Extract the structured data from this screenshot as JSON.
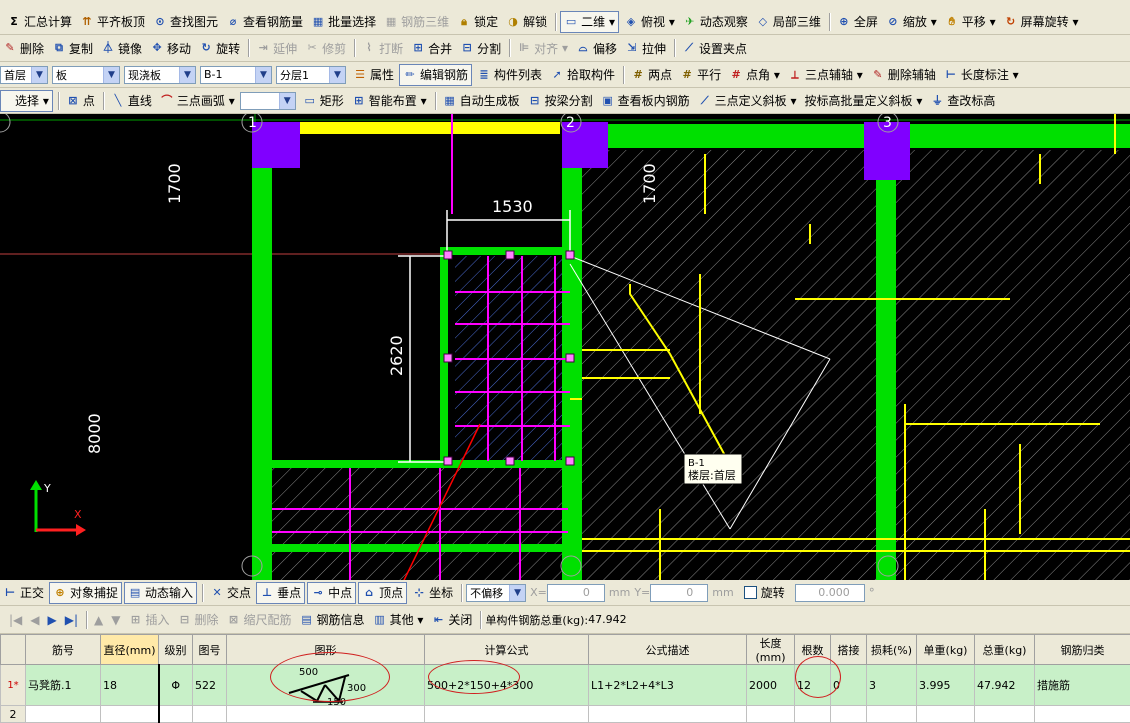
{
  "toolbar1": {
    "items": [
      "汇总计算",
      "平齐板顶",
      "查找图元",
      "查看钢筋量",
      "批量选择",
      "钢筋三维",
      "锁定",
      "解锁",
      "二维",
      "俯视",
      "动态观察",
      "局部三维",
      "全屏",
      "缩放",
      "平移",
      "屏幕旋转"
    ]
  },
  "toolbar2": {
    "items": [
      "删除",
      "复制",
      "镜像",
      "移动",
      "旋转",
      "延伸",
      "修剪",
      "打断",
      "合并",
      "分割",
      "对齐",
      "偏移",
      "拉伸",
      "设置夹点"
    ]
  },
  "toolbar3": {
    "floor": "首层",
    "category": "板",
    "subtype": "现浇板",
    "element": "B-1",
    "layer": "分层1",
    "items": [
      "属性",
      "编辑钢筋",
      "构件列表",
      "拾取构件",
      "两点",
      "平行",
      "点角",
      "三点辅轴",
      "删除辅轴",
      "长度标注"
    ]
  },
  "toolbar4": {
    "select": "选择",
    "items": [
      "点",
      "直线",
      "三点画弧",
      "矩形",
      "智能布置",
      "自动生成板",
      "按梁分割",
      "查看板内钢筋",
      "三点定义斜板",
      "按标高批量定义斜板",
      "查改标高"
    ]
  },
  "canvas": {
    "dims": {
      "d1700a": "1700",
      "d1700b": "1700",
      "d1530": "1530",
      "d2620": "2620",
      "d8000": "8000"
    },
    "axis_labels": [
      "1",
      "2",
      "3"
    ],
    "tooltip": {
      "line1": "B-1",
      "line2": "楼层:首层"
    },
    "ucs": {
      "x": "X",
      "y": "Y"
    }
  },
  "snapbar": {
    "items": [
      "正交",
      "对象捕捉",
      "动态输入",
      "交点",
      "垂点",
      "中点",
      "顶点",
      "坐标"
    ],
    "offset_mode": "不偏移",
    "x_label": "X=",
    "x_value": "0",
    "y_label": "Y=",
    "y_value": "0",
    "unit": "mm",
    "rotate_label": "旋转",
    "rotate_value": "0.000",
    "deg": "°"
  },
  "infobar": {
    "items": [
      "插入",
      "删除",
      "缩尺配筋",
      "钢筋信息",
      "其他",
      "关闭"
    ],
    "total_label": "单构件钢筋总重(kg):",
    "total_value": "47.942"
  },
  "table": {
    "headers": [
      "筋号",
      "直径(mm)",
      "级别",
      "图号",
      "图形",
      "计算公式",
      "公式描述",
      "长度(mm)",
      "根数",
      "搭接",
      "损耗(%)",
      "单重(kg)",
      "总重(kg)",
      "钢筋归类"
    ],
    "rows": [
      {
        "idx": "1*",
        "name": "马凳筋.1",
        "diameter": "18",
        "grade": "Φ",
        "fig": "522",
        "shape_top": "500",
        "shape_right": "300",
        "shape_bottom": "150",
        "formula": "500+2*150+4*300",
        "desc": "L1+2*L2+4*L3",
        "length": "2000",
        "count": "12",
        "lap": "0",
        "loss": "3",
        "unit_w": "3.995",
        "total_w": "47.942",
        "category": "措施筋"
      },
      {
        "idx": "2"
      }
    ]
  },
  "colors": {
    "wall": "#00e000",
    "column": "#8000ff",
    "beam": "#ffff00",
    "rebar": "#ff00ff",
    "annot": "#ff0000"
  }
}
